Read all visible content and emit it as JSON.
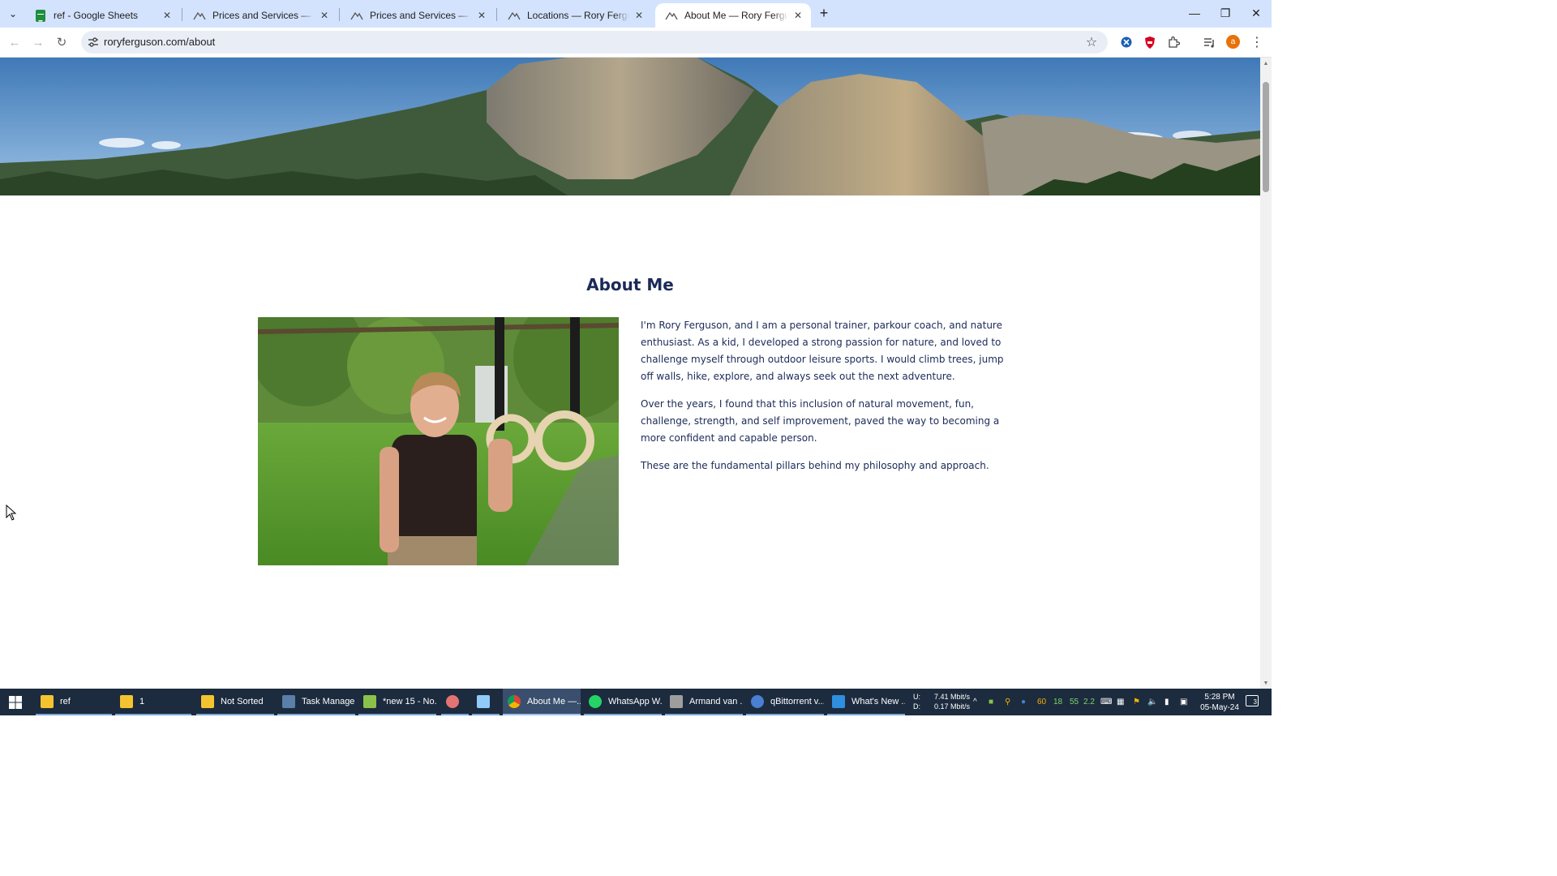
{
  "browser": {
    "tabs": [
      {
        "title": "ref - Google Sheets",
        "favicon": "google-sheets-icon",
        "active": false
      },
      {
        "title": "Prices and Services — Rory Ferguson",
        "favicon": "site-logo-icon",
        "active": false
      },
      {
        "title": "Prices and Services — Rory Ferguson",
        "favicon": "site-logo-icon",
        "active": false
      },
      {
        "title": "Locations — Rory Ferguson - Parkour",
        "favicon": "site-logo-icon",
        "active": false
      },
      {
        "title": "About Me — Rory Ferguson - Parkour",
        "favicon": "site-logo-icon",
        "active": true
      }
    ],
    "url": "roryferguson.com/about",
    "profile_initial": "a",
    "icons": [
      "back-icon",
      "forward-icon",
      "reload-icon",
      "site-info-icon",
      "bookmark-star-icon",
      "extension-icon",
      "media-control-icon",
      "menu-icon"
    ]
  },
  "page": {
    "heading": "About Me",
    "paragraphs": [
      "I'm Rory Ferguson, and I am a personal trainer, parkour coach, and nature enthusiast. As a kid, I developed a strong passion for nature, and loved to challenge myself through outdoor leisure sports. I would climb trees, jump off walls, hike, explore, and always seek out the next adventure.",
      "Over the years, I found that this inclusion of natural movement, fun, challenge, strength, and self improvement, paved the way to becoming a more confident and capable person.",
      "These are the fundamental pillars behind my philosophy and approach."
    ],
    "colors": {
      "heading": "#1b2a57",
      "body_text": "#1b2a57",
      "tab_strip": "#d3e3fd"
    }
  },
  "taskbar": {
    "items": [
      {
        "label": "ref",
        "icon": "folder-icon"
      },
      {
        "label": "1",
        "icon": "folder-icon"
      },
      {
        "label": "Not Sorted",
        "icon": "folder-icon"
      },
      {
        "label": "Task Manager",
        "icon": "task-manager-icon"
      },
      {
        "label": "*new 15 - No...",
        "icon": "notepad-plus-icon"
      },
      {
        "label": "",
        "icon": "app-icon"
      },
      {
        "label": "",
        "icon": "document-icon"
      },
      {
        "label": "About Me —...",
        "icon": "chrome-icon"
      },
      {
        "label": "WhatsApp W...",
        "icon": "whatsapp-icon"
      },
      {
        "label": "Armand van ...",
        "icon": "media-player-icon"
      },
      {
        "label": "qBittorrent v...",
        "icon": "qbittorrent-icon"
      },
      {
        "label": "What's New ...",
        "icon": "vscode-icon"
      }
    ],
    "network": {
      "up_label": "U:",
      "down_label": "D:",
      "up": "7.41 Mbit/s",
      "down": "0.17 Mbit/s"
    },
    "tray_numbers": [
      "60",
      "18",
      "55",
      "2.2"
    ],
    "time": "5:28 PM",
    "date": "05-May-24",
    "notifications": "3"
  }
}
